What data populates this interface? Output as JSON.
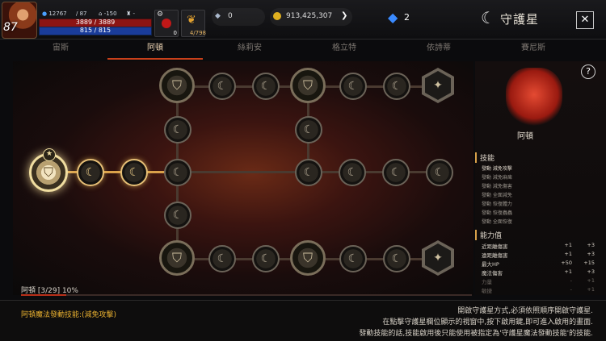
{
  "header": {
    "level": "87",
    "stats": [
      "12767",
      "87",
      "-150",
      "-"
    ],
    "hp_text": "3889 / 3889",
    "hp_fraction": 1.0,
    "mp_text": "815 / 815",
    "mp_fraction": 1.0,
    "potion_count": "0",
    "item_count": "4/798",
    "gem_count": "0",
    "gold": "913,425,307",
    "crystal_count": "2",
    "title": "守護星",
    "close_label": "✕"
  },
  "tabs": [
    "宙斯",
    "阿頓",
    "絲莉安",
    "格立特",
    "依詩蒂",
    "賽尼斯"
  ],
  "active_tab": "阿頓",
  "progress": {
    "label": "阿頓 [3/29] 10%",
    "percent": 10
  },
  "panel": {
    "help_label": "?",
    "name": "阿頓",
    "skills_title": "技能",
    "skills": [
      "發動 減免攻擊",
      "發動 減免麻痺",
      "發動 減免傷害",
      "發動 全面減免",
      "發動 恢復體力",
      "發動 恢復蟲蟲",
      "發動 全面恢復"
    ],
    "stats_title": "能力值",
    "stats": [
      {
        "name": "近距離傷害",
        "a": "+1",
        "b": "+3"
      },
      {
        "name": "遠距離傷害",
        "a": "+1",
        "b": "+3"
      },
      {
        "name": "最大HP",
        "a": "+50",
        "b": "+15"
      },
      {
        "name": "魔法傷害",
        "a": "+1",
        "b": "+3"
      },
      {
        "name": "力量",
        "a": "-",
        "b": "+1"
      },
      {
        "name": "敏捷",
        "a": "-",
        "b": "+1"
      }
    ]
  },
  "footer": {
    "magic_skill": "阿頓魔法發動技能:(減免攻擊)",
    "instructions": [
      "開啟守護星方式,必須依照順序開啟守護星.",
      "在點擊守護星欄位顯示的視窗中,按下啟用鍵,即可進入啟用的畫面.",
      "發動技能的話,技能啟用後只能使用被指定為'守護星魔法發動技能'的技能."
    ]
  },
  "colors": {
    "accent": "#c8401a",
    "lit": "#e7c077",
    "magic_text": "#e8b030"
  },
  "icons": [
    "user-icon",
    "sword-icon",
    "home-icon",
    "trophy-icon",
    "gear-icon",
    "potion-icon",
    "feather-icon",
    "gem-icon",
    "coin-icon",
    "arrow-right-icon",
    "crystal-icon",
    "star-logo-icon",
    "close-icon",
    "help-icon",
    "shield-node-icon",
    "moon-node-icon"
  ]
}
